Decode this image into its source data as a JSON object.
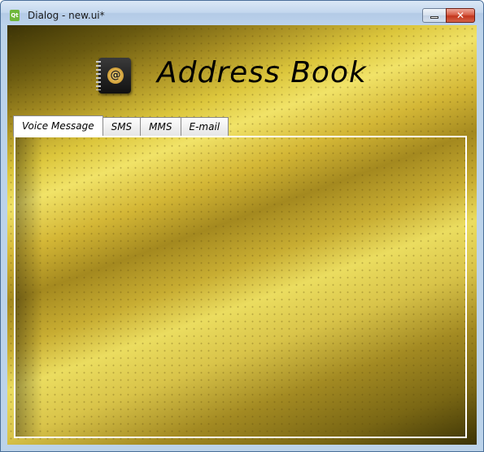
{
  "window": {
    "title": "Dialog - new.ui*",
    "app_icon_text": "Qt",
    "close_glyph": "✕"
  },
  "header": {
    "title": "Address Book",
    "logo_icon_glyph": "@"
  },
  "tabs": [
    {
      "label": "Voice Message",
      "active": true
    },
    {
      "label": "SMS",
      "active": false
    },
    {
      "label": "MMS",
      "active": false
    },
    {
      "label": "E-mail",
      "active": false
    }
  ],
  "colors": {
    "gold_light": "#f1e368",
    "gold_dark": "#3b3306",
    "title_bar": "#c3d7ee",
    "close_button": "#c3361d"
  }
}
